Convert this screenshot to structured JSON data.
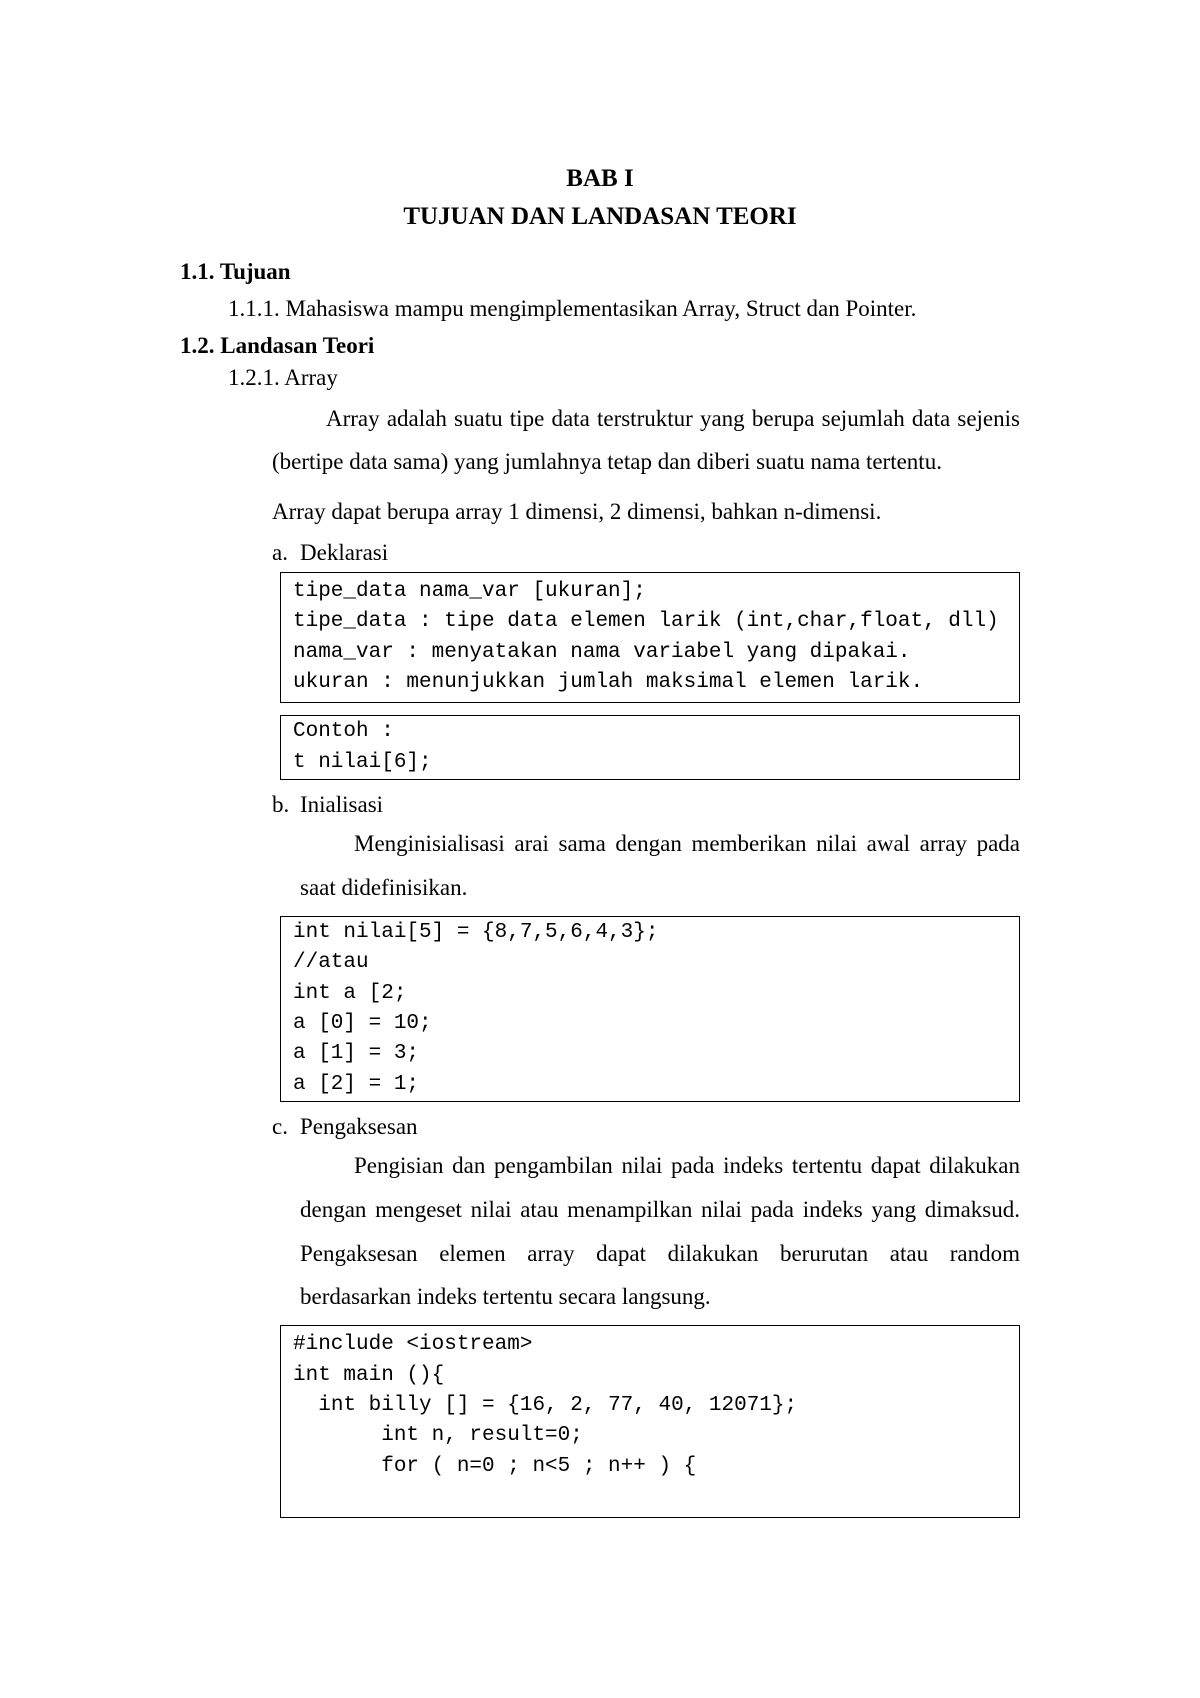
{
  "chapter": {
    "number": "BAB I",
    "title": "TUJUAN DAN LANDASAN TEORI"
  },
  "section1": {
    "heading": "1.1. Tujuan",
    "item1": "1.1.1. Mahasiswa mampu mengimplementasikan Array, Struct dan Pointer."
  },
  "section2": {
    "heading": "1.2. Landasan Teori",
    "subhead": "1.2.1. Array",
    "para1": "Array adalah suatu tipe data terstruktur yang berupa sejumlah data sejenis (bertipe data sama) yang jumlahnya tetap dan diberi suatu nama tertentu.",
    "para2": "Array dapat berupa array 1 dimensi, 2 dimensi, bahkan n-dimensi.",
    "itemA": {
      "label": "a.",
      "title": "Deklarasi",
      "code1": "tipe_data nama_var [ukuran];\ntipe_data : tipe data elemen larik (int,char,float, dll)\nnama_var : menyatakan nama variabel yang dipakai.\nukuran : menunjukkan jumlah maksimal elemen larik.",
      "code2": "Contoh :\nt nilai[6];"
    },
    "itemB": {
      "label": "b.",
      "title": "Inialisasi",
      "para": "Menginisialisasi arai sama dengan memberikan nilai awal array pada saat didefinisikan.",
      "code": "int nilai[5] = {8,7,5,6,4,3};\n//atau\nint a [2;\na [0] = 10;\na [1] = 3;\na [2] = 1;"
    },
    "itemC": {
      "label": "c.",
      "title": "Pengaksesan",
      "para": "Pengisian dan pengambilan nilai pada indeks tertentu dapat dilakukan dengan mengeset nilai atau menampilkan nilai pada indeks yang dimaksud. Pengaksesan elemen array dapat dilakukan berurutan atau random berdasarkan indeks tertentu secara langsung.",
      "code": "#include <iostream>\nint main (){\n  int billy [] = {16, 2, 77, 40, 12071};\n       int n, result=0;\n       for ( n=0 ; n<5 ; n++ ) {\n\n"
    }
  }
}
